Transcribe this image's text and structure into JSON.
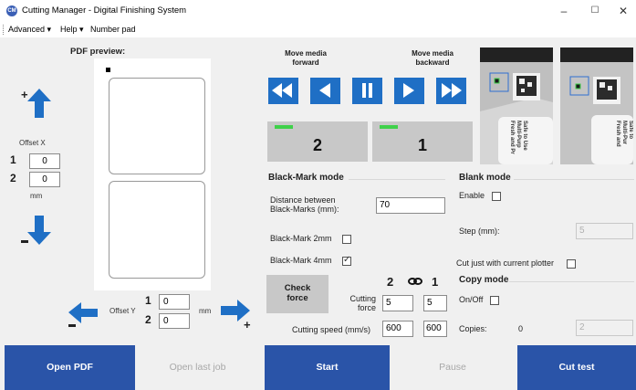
{
  "window": {
    "app_icon_text": "CM",
    "title": "Cutting Manager - Digital Finishing System",
    "minimize": "–",
    "maximize": "☐",
    "close": "✕"
  },
  "menu": {
    "advanced": "Advanced ▾",
    "help": "Help ▾",
    "number_pad": "Number pad"
  },
  "pdf_preview": {
    "title": "PDF preview:"
  },
  "offset_x": {
    "label": "Offset X",
    "row1_label": "1",
    "row1_value": "0",
    "row2_label": "2",
    "row2_value": "0",
    "unit": "mm"
  },
  "offset_y": {
    "label": "Offset Y",
    "row1_label": "1",
    "row1_value": "0",
    "row2_label": "2",
    "row2_value": "0",
    "unit": "mm"
  },
  "media": {
    "forward_label": "Move media\nforward",
    "backward_label": "Move media\nbackward",
    "counter_left": "2",
    "counter_right": "1"
  },
  "blackmark": {
    "title": "Black-Mark mode",
    "distance_label": "Distance between\nBlack-Marks (mm):",
    "distance_value": "70",
    "bm2_label": "Black-Mark 2mm",
    "bm2_checked": false,
    "bm4_label": "Black-Mark 4mm",
    "bm4_checked": true
  },
  "blank": {
    "title": "Blank mode",
    "enable_label": "Enable",
    "step_label": "Step (mm):",
    "step_value": "5"
  },
  "cut_current": {
    "label": "Cut just with current plotter"
  },
  "force": {
    "check_force": "Check\nforce",
    "head_left": "2",
    "head_right": "1",
    "cutting_force_label": "Cutting\nforce",
    "force_left": "5",
    "force_right": "5",
    "speed_label": "Cutting speed (mm/s)",
    "speed_left": "600",
    "speed_right": "600"
  },
  "copy": {
    "title": "Copy mode",
    "onoff_label": "On/Off",
    "copies_label": "Copies:",
    "copies_count": "0",
    "copies_value": "2"
  },
  "camera": {
    "left_text": "Safe to Use\nMulti-Purp\nFresh and Pr",
    "right_text": "Safe to\nMulti-Pur\nFresh and"
  },
  "bottom": {
    "open_pdf": "Open PDF",
    "open_last": "Open last job",
    "start": "Start",
    "pause": "Pause",
    "cut_test": "Cut test"
  },
  "colors": {
    "primary": "#2a54a8",
    "arrow_blue": "#1f6fc5",
    "counter_green": "#3fd14a"
  }
}
